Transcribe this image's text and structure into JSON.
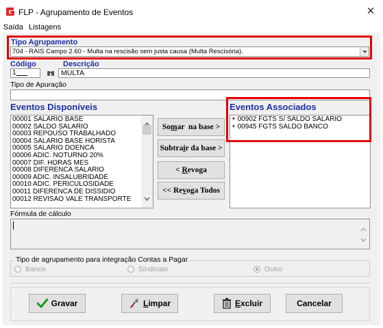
{
  "window": {
    "title": "FLP - Agrupamento de Eventos",
    "close_glyph": "×"
  },
  "menu": {
    "items": [
      "Saída",
      "Listagens"
    ]
  },
  "tipo_agrupamento": {
    "label": "Tipo Agrupamento",
    "value": "704 - RAIS Campo 2.60 - Multa na rescisão sem justa causa (Multa Rescisória)."
  },
  "codigo": {
    "label": "Código",
    "value": "1"
  },
  "descricao": {
    "label": "Descrição",
    "value": "MULTA"
  },
  "tipo_apuracao": {
    "label": "Tipo de Apuração",
    "value": ""
  },
  "eventos_disponiveis": {
    "label": "Eventos Disponíveis",
    "items": [
      "00001 SALARIO BASE",
      "00002 SALDO SALARIO",
      "00003 REPOUSO TRABALHADO",
      "00004 SALARIO BASE HORISTA",
      "00005 SALARIO DOENCA",
      "00006 ADIC. NOTURNO 20%",
      "00007 DIF. HORAS MES",
      "00008 DIFERENCA SALARIO",
      "00009 ADIC. INSALUBRIDADE",
      "00010 ADIC. PERICULOSIDADE",
      "00011 DIFERENCA DE DISSIDIO",
      "00012 REVISAO VALE TRANSPORTE"
    ]
  },
  "eventos_associados": {
    "label": "Eventos Associados",
    "items": [
      "+ 00902 FGTS S/ SALDO SALARIO",
      "+ 00945 FGTS SALDO BANCO"
    ]
  },
  "actions": {
    "somar": {
      "pre": "So",
      "key": "m",
      "post": "ar  na base >"
    },
    "subtrair": {
      "pre": "Subtra",
      "key": "i",
      "post": "r da base >"
    },
    "revoga": {
      "pre": "< ",
      "key": "R",
      "post": "evoga"
    },
    "revoga_todos": {
      "pre": "<< Re",
      "key": "v",
      "post": "oga Todos"
    }
  },
  "formula": {
    "label": "Fórmula de cálculo",
    "value": ""
  },
  "integracao": {
    "legend": "Tipo de agrupamento para integração Contas a Pagar",
    "options": [
      "Banco",
      "Sindicato",
      "Outro"
    ],
    "selected": "Outro"
  },
  "bottom": {
    "gravar": "Gravar",
    "limpar": {
      "key": "L",
      "rest": "impar"
    },
    "excluir": {
      "key": "E",
      "rest": "xcluir"
    },
    "cancelar": "Cancelar"
  },
  "colors": {
    "accent_red": "#e20000",
    "label_blue": "#1c2fa5",
    "app_icon_red": "#e0262b"
  }
}
